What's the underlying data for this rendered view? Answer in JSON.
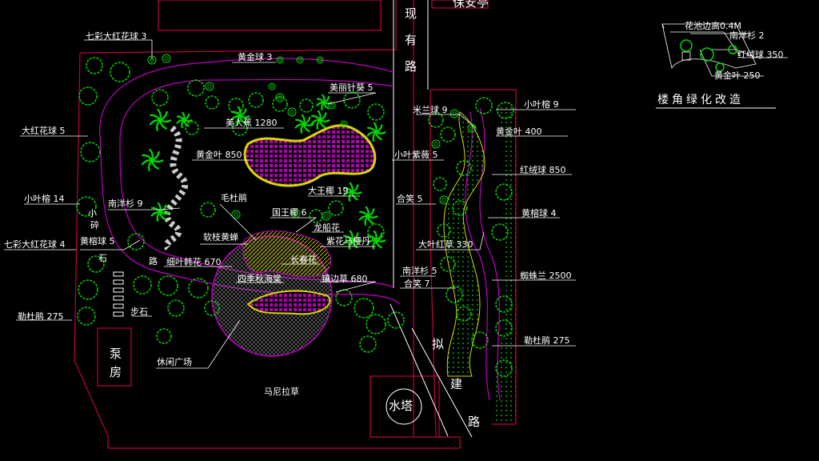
{
  "colors": {
    "background": "#000000",
    "boundary": "#c0004a",
    "path": "#c000c0",
    "plant": "#00d800",
    "leader": "#ffffff",
    "hatch_yellow": "#d8d800",
    "hatch_magenta": "#b000b0"
  },
  "labels": {
    "qicai_top": "七彩大红花球 3",
    "huangjinqiu": "黄金球 3",
    "meilizhenkui": "美丽针葵 5",
    "meirenjiao": "美人蕉 1280",
    "dahonghuaqiu": "大红花球 5",
    "huangjinye": "黄金叶 850",
    "xiaoyerong_left": "小叶榕 14",
    "nanyangshan": "南洋杉 9",
    "maodujuan": "毛杜鹃",
    "dawangye": "大王椰 19",
    "guowangye": "国王椰 6",
    "longchuanhua": "龙船花",
    "zihuamayingdan": "紫花马樱丹",
    "ruanzhihuangchan": "软枝黄蝉",
    "qicai_left": "七彩大红花球 4",
    "huangzongqiu_left": "黄榕球 5",
    "xiyezhuhua": "细叶韩花 670",
    "sijiqiuhaitang": "四季秋海棠",
    "changchunhua": "长春花",
    "jinbiancao": "镶边草 680",
    "dujuan_left": "勒杜鹃 275",
    "buzhi": "步石",
    "xiuxianguangchang": "休闲广场",
    "maniolacao": "马尼拉草",
    "milanqiu": "米兰球 9",
    "xiaoyeziwei": "小叶紫薇 5",
    "hexiao_mid": "合笑 5",
    "dayehongcao": "大叶红草 330",
    "nanyangshan_right": "南洋杉 5",
    "hexiao_low": "合笑 7",
    "xiaoyerong_right": "小叶榕 9",
    "huangjinye_right": "黄金叶 400",
    "hongrongqiu": "红绒球 850",
    "huangzongqiu_right": "黄榕球 4",
    "zhizhulan": "蜘蛛兰 2500",
    "dujuan_right": "勒杜鹃 275",
    "baoanting": "保安亭",
    "bengfang": "泵房",
    "shuita": "水塔",
    "road_existing": [
      "现",
      "有",
      "路"
    ],
    "road_planned": [
      "拟",
      "建",
      "路"
    ],
    "path_left": [
      "小",
      "碎",
      "石",
      "路"
    ],
    "title": "楼角绿化改造",
    "corner_huachi": "花池边高0.4M",
    "corner_nanyangshan": "南洋杉 2",
    "corner_hongrongqiu": "红绒球 350",
    "corner_huangjinye": "黄金叶 250"
  }
}
